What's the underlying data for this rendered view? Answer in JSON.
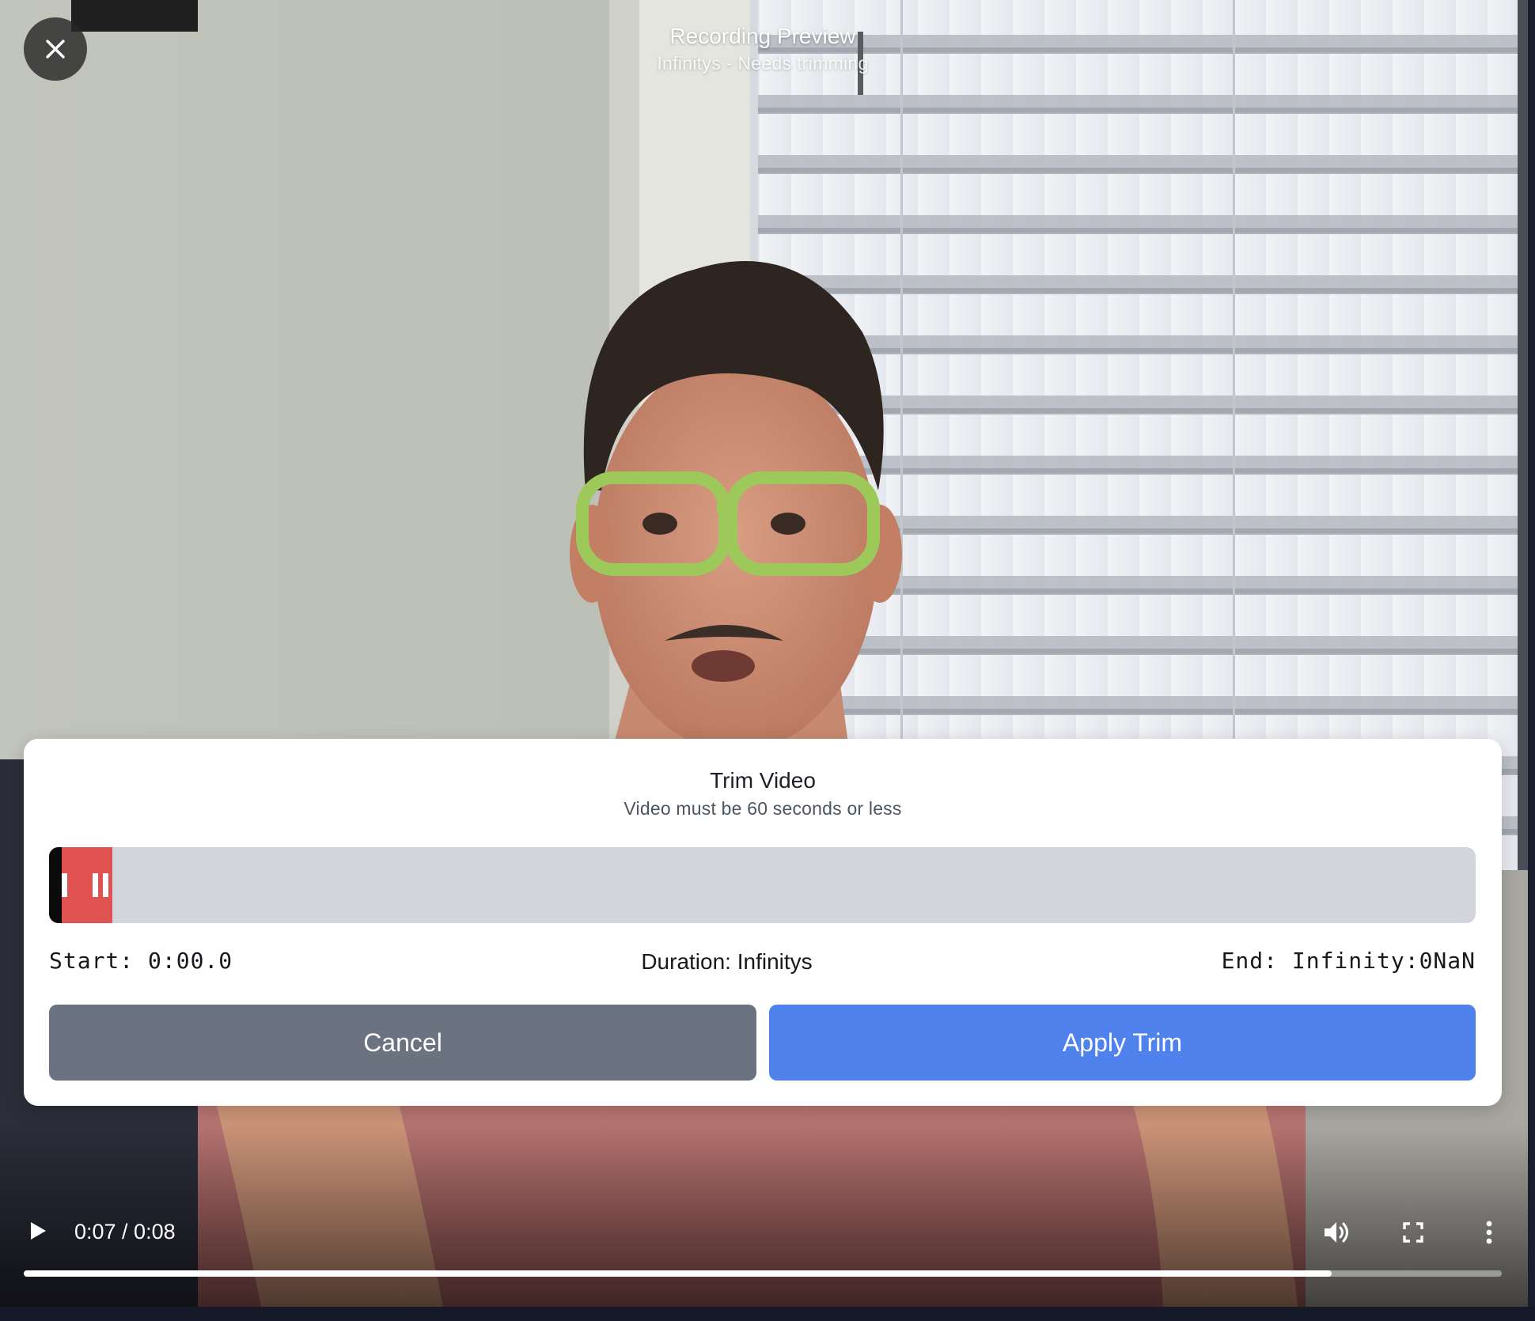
{
  "header": {
    "title": "Recording Preview",
    "subtitle": "Infinitys - Needs trimming"
  },
  "trim": {
    "title": "Trim Video",
    "subtitle": "Video must be 60 seconds or less",
    "start_label": "Start: 0:00.0",
    "duration_label": "Duration: Infinitys",
    "end_label": "End: Infinity:0NaN",
    "cancel_label": "Cancel",
    "apply_label": "Apply Trim"
  },
  "player": {
    "time": "0:07 / 0:08",
    "progress_fraction": 0.885
  },
  "icons": {
    "close": "close-icon",
    "play": "play-icon",
    "volume": "volume-icon",
    "fullscreen": "fullscreen-icon",
    "more": "more-vertical-icon"
  },
  "colors": {
    "selection": "#e0524f",
    "apply": "#4f82ed",
    "cancel": "#6b7280",
    "track": "#d2d5db"
  }
}
